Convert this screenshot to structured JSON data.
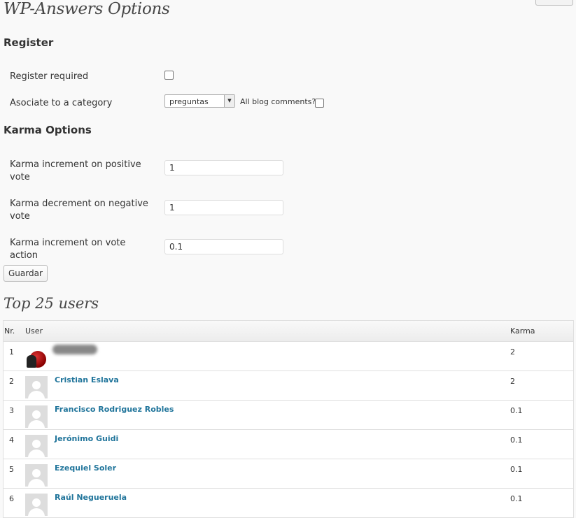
{
  "page_title": "WP-Answers Options",
  "register": {
    "heading": "Register",
    "register_required_label": "Register required",
    "register_required_checked": false,
    "category_label": "Asociate to a category",
    "category_selected": "preguntas",
    "all_comments_label": "All blog comments?",
    "all_comments_checked": false
  },
  "karma": {
    "heading": "Karma Options",
    "positive_vote_label": "Karma increment on positive vote",
    "positive_vote_value": "1",
    "negative_vote_label": "Karma decrement on negative vote",
    "negative_vote_value": "1",
    "vote_action_label": "Karma increment on vote action",
    "vote_action_value": "0.1"
  },
  "save_label": "Guardar",
  "top_users": {
    "heading": "Top 25 users",
    "columns": {
      "nr": "Nr.",
      "user": "User",
      "karma": "Karma"
    },
    "rows": [
      {
        "nr": "1",
        "user": "",
        "karma": "2"
      },
      {
        "nr": "2",
        "user": "Cristian Eslava",
        "karma": "2"
      },
      {
        "nr": "3",
        "user": "Francisco Rodriguez Robles",
        "karma": "0.1"
      },
      {
        "nr": "4",
        "user": "Jerónimo Guidi",
        "karma": "0.1"
      },
      {
        "nr": "5",
        "user": "Ezequiel Soler",
        "karma": "0.1"
      },
      {
        "nr": "6",
        "user": "Raúl Negueruela",
        "karma": "0.1"
      }
    ]
  }
}
